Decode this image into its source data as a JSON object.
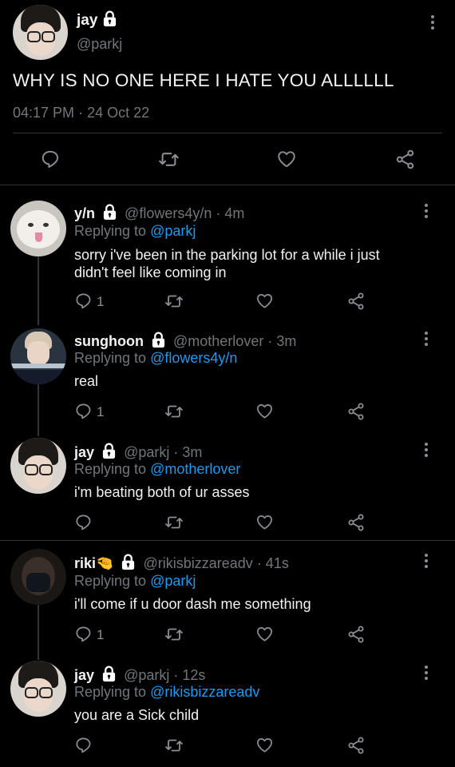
{
  "main_tweet": {
    "name": "jay",
    "handle": "@parkj",
    "text": "WHY IS NO ONE HERE I HATE YOU ALLLLLL",
    "time": "04:17 PM",
    "date": "24 Oct 22",
    "separator": "·"
  },
  "replies": [
    {
      "name": "y/n",
      "handle": "@flowers4y/n",
      "time": "· 4m",
      "replying_prefix": "Replying to",
      "replying_to": "@parkj",
      "text_line1": "sorry i've been in the parking lot for a while i just",
      "text_line2": "didn't feel like coming in",
      "reply_count": "1",
      "avatar": "cat-avatar"
    },
    {
      "name": "sunghoon",
      "handle": "@motherlover",
      "time": "· 3m",
      "replying_prefix": "Replying to",
      "replying_to": "@flowers4y/n",
      "text_line1": "real",
      "reply_count": "1",
      "avatar": "sunghoon-avatar"
    },
    {
      "name": "jay",
      "handle": "@parkj",
      "time": "· 3m",
      "replying_prefix": "Replying to",
      "replying_to": "@motherlover",
      "text_line1": "i'm beating both of ur asses",
      "reply_count": "",
      "avatar": "jay-avatar"
    },
    {
      "name": "riki",
      "name_emoji": "🤏",
      "handle": "@rikisbizzareadv",
      "time": "· 41s",
      "replying_prefix": "Replying to",
      "replying_to": "@parkj",
      "text_line1": "i'll come if u door dash me something",
      "reply_count": "1",
      "avatar": "riki-avatar"
    },
    {
      "name": "jay",
      "handle": "@parkj",
      "time": "· 12s",
      "replying_prefix": "Replying to",
      "replying_to": "@rikisbizzareadv",
      "text_line1": "you are a Sick child",
      "reply_count": "",
      "avatar": "jay-avatar"
    }
  ],
  "icons": {
    "reply": "reply-icon",
    "retweet": "retweet-icon",
    "like": "heart-icon",
    "share": "share-icon",
    "lock": "lock-icon",
    "more": "more-icon"
  },
  "colors": {
    "background": "#000000",
    "text": "#e7e9ea",
    "secondary": "#71767b",
    "link": "#1d9bf0"
  }
}
